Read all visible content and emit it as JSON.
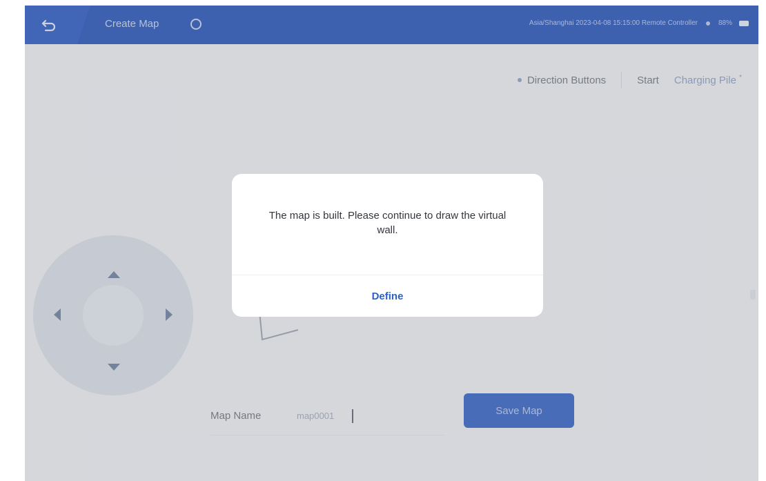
{
  "header": {
    "title": "Create Map",
    "status_text": "Asia/Shanghai 2023-04-08 15:15:00  Remote Controller",
    "battery_text": "88%"
  },
  "toolbar": {
    "direction_buttons_label": "Direction Buttons",
    "start_label": "Start",
    "charging_pile_label": "Charging Pile",
    "charging_pile_marker": "*"
  },
  "map_form": {
    "label": "Map Name",
    "value": "map0001",
    "save_button_label": "Save Map"
  },
  "dialog": {
    "message": "The map is built. Please continue to draw the virtual wall.",
    "button_label": "Define"
  },
  "colors": {
    "header_bg": "#1f4fb8",
    "accent": "#2a62c9",
    "primary_button": "#2f5fc4"
  }
}
